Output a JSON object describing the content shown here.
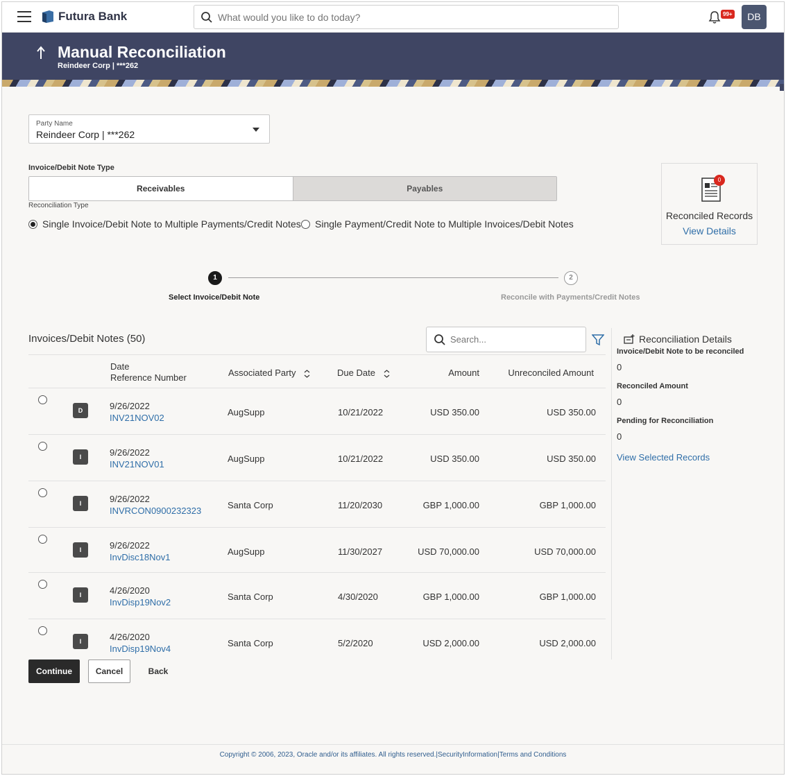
{
  "topbar": {
    "brand": "Futura Bank",
    "search_placeholder": "What would you like to do today?",
    "notification_badge": "99+",
    "avatar_initials": "DB",
    "brand_color": "#3f4563"
  },
  "header": {
    "title": "Manual Reconciliation",
    "subtitle": "Reindeer Corp | ***262"
  },
  "party": {
    "label": "Party Name",
    "value": "Reindeer Corp | ***262"
  },
  "invoice_type": {
    "label": "Invoice/Debit Note Type",
    "options": [
      "Receivables",
      "Payables"
    ],
    "selected": "Receivables"
  },
  "reconciliation_type": {
    "label": "Reconciliation Type",
    "options": [
      "Single Invoice/Debit Note to Multiple Payments/Credit Notes",
      "Single Payment/Credit Note to Multiple Invoices/Debit Notes"
    ],
    "selected_index": 0
  },
  "reconciled_card": {
    "count": "0",
    "title": "Reconciled Records",
    "link": "View Details"
  },
  "stepper": {
    "steps": [
      {
        "number": "1",
        "label": "Select Invoice/Debit Note"
      },
      {
        "number": "2",
        "label": "Reconcile with Payments/Credit Notes"
      }
    ],
    "current_step": 1
  },
  "table": {
    "title": "Invoices/Debit Notes (50)",
    "search_placeholder": "Search...",
    "headers": {
      "date": "Date",
      "ref": "Reference Number",
      "party": "Associated Party",
      "due": "Due Date",
      "amount": "Amount",
      "unreconciled": "Unreconciled Amount"
    },
    "rows": [
      {
        "type": "D",
        "date": "9/26/2022",
        "ref": "INV21NOV02",
        "party": "AugSupp",
        "due": "10/21/2022",
        "amount": "USD 350.00",
        "unreconciled": "USD 350.00"
      },
      {
        "type": "I",
        "date": "9/26/2022",
        "ref": "INV21NOV01",
        "party": "AugSupp",
        "due": "10/21/2022",
        "amount": "USD 350.00",
        "unreconciled": "USD 350.00"
      },
      {
        "type": "I",
        "date": "9/26/2022",
        "ref": "INVRCON0900232323",
        "party": "Santa Corp",
        "due": "11/20/2030",
        "amount": "GBP 1,000.00",
        "unreconciled": "GBP 1,000.00"
      },
      {
        "type": "I",
        "date": "9/26/2022",
        "ref": "InvDisc18Nov1",
        "party": "AugSupp",
        "due": "11/30/2027",
        "amount": "USD 70,000.00",
        "unreconciled": "USD 70,000.00"
      },
      {
        "type": "I",
        "date": "4/26/2020",
        "ref": "InvDisp19Nov2",
        "party": "Santa Corp",
        "due": "4/30/2020",
        "amount": "GBP 1,000.00",
        "unreconciled": "GBP 1,000.00"
      },
      {
        "type": "I",
        "date": "4/26/2020",
        "ref": "InvDisp19Nov4",
        "party": "Santa Corp",
        "due": "5/2/2020",
        "amount": "USD 2,000.00",
        "unreconciled": "USD 2,000.00"
      }
    ]
  },
  "details": {
    "title": "Reconciliation Details",
    "to_be_reconciled_label": "Invoice/Debit Note to be reconciled",
    "to_be_reconciled_value": "0",
    "reconciled_amount_label": "Reconciled Amount",
    "reconciled_amount_value": "0",
    "pending_label": "Pending for Reconciliation",
    "pending_value": "0",
    "link": "View Selected Records"
  },
  "actions": {
    "continue": "Continue",
    "cancel": "Cancel",
    "back": "Back"
  },
  "footer": {
    "text": "Copyright © 2006, 2023, Oracle and/or its affiliates. All rights reserved.|SecurityInformation|Terms and Conditions"
  }
}
